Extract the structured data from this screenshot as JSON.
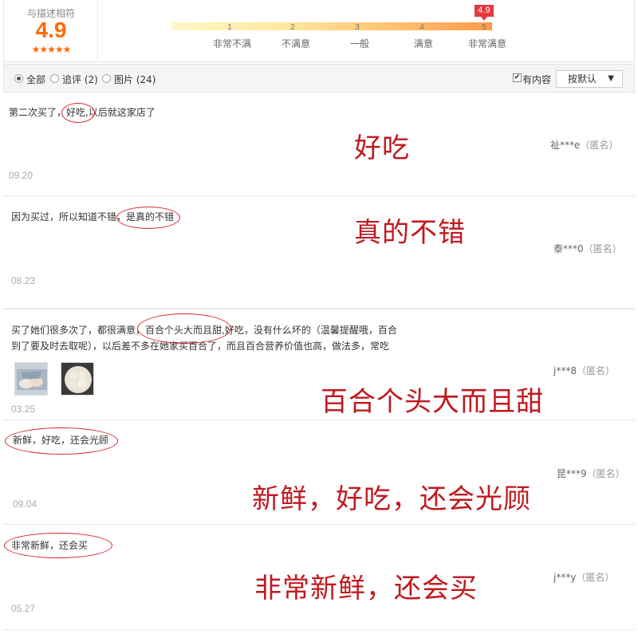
{
  "rating": {
    "label": "与描述相符",
    "score": "4.9",
    "stars": "★★★★★",
    "scale": {
      "numbers": [
        "1",
        "2",
        "3",
        "4",
        "5"
      ],
      "labels": [
        "非常不满",
        "不满意",
        "一般",
        "满意",
        "非常满意"
      ],
      "flag": "4.9",
      "level": 0.975
    }
  },
  "filter": {
    "options": [
      {
        "label": "全部",
        "selected": true
      },
      {
        "label": "追评 (2)",
        "selected": false
      },
      {
        "label": "图片 (24)",
        "selected": false
      }
    ],
    "has_content_label": "有内容",
    "has_content_checked": "✔",
    "sort_label": "按默认",
    "sort_chevron": "▼"
  },
  "reviews": [
    {
      "text_before": "第二次买了，",
      "text_highlight": "好吃,",
      "text_after": "以后就这家店了",
      "user": "祉***e",
      "anon": "（匿名）",
      "date": "09.20",
      "annotation": "好吃"
    },
    {
      "text_before": "因为买过，所以知道不错，",
      "text_highlight": "是真的不错",
      "text_after": "",
      "user": "泰***0",
      "anon": "（匿名）",
      "date": "08.23",
      "annotation": "真的不错"
    },
    {
      "line1_before": "买了她们很多次了，都很满意，",
      "line1_highlight": "百合个头大而且甜,",
      "line1_after": "好吃，没有什么坏的（温馨提醒哦，百合",
      "line2": "到了要及时去取呢），以后差不多在她家买百合了，而且百合营养价值也高，做法多，常吃",
      "user": "j***8",
      "anon": "（匿名）",
      "date": "03.25",
      "annotation": "百合个头大而且甜"
    },
    {
      "text": "新鲜，好吃，还会光顾",
      "user": "昆***9",
      "anon": "（匿名）",
      "date": "09.04",
      "annotation": "新鲜，好吃，还会光顾"
    },
    {
      "text": "非常新鲜，还会买",
      "user": "j***y",
      "anon": "（匿名）",
      "date": "05.27",
      "annotation": "非常新鲜，还会买"
    }
  ]
}
